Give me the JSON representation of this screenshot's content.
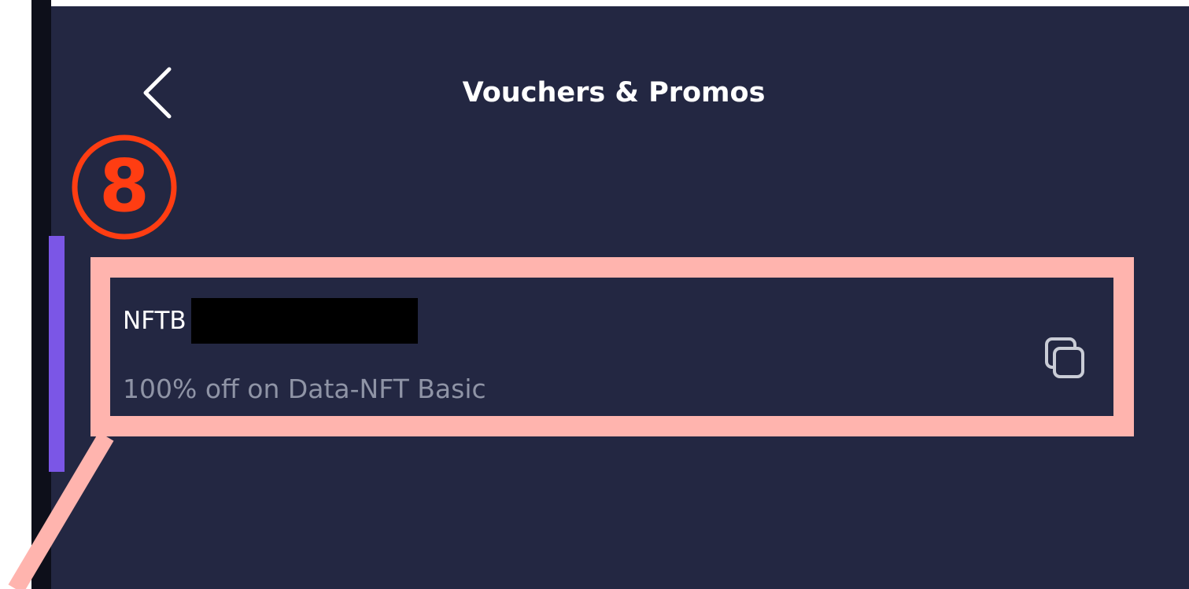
{
  "header": {
    "title": "Vouchers & Promos"
  },
  "annotation": {
    "step_number": "8"
  },
  "voucher": {
    "code_visible": "NFTB",
    "description": "100% off on Data-NFT Basic"
  },
  "icons": {
    "back": "chevron-left-icon",
    "copy": "copy-icon"
  },
  "colors": {
    "background": "#232742",
    "accent": "#7b56e6",
    "highlight": "#ffb4ae",
    "annotation": "#ff3d12",
    "secondary_text": "#8f94a6"
  }
}
